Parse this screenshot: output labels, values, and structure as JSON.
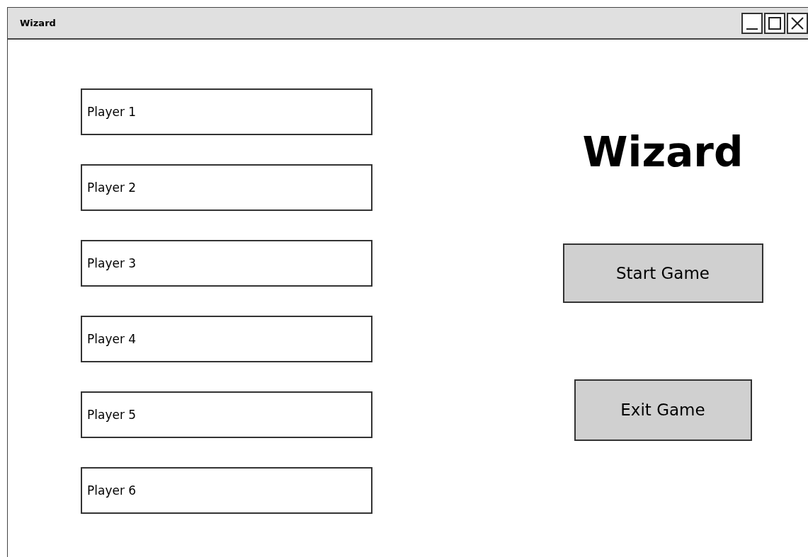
{
  "window": {
    "title": "Wizard"
  },
  "player_fields": [
    {
      "value": "Player 1"
    },
    {
      "value": "Player 2"
    },
    {
      "value": "Player 3"
    },
    {
      "value": "Player 4"
    },
    {
      "value": "Player 5"
    },
    {
      "value": "Player 6"
    }
  ],
  "heading": "Wizard",
  "buttons": [
    {
      "label": "Start Game"
    },
    {
      "label": "Exit Game"
    }
  ]
}
